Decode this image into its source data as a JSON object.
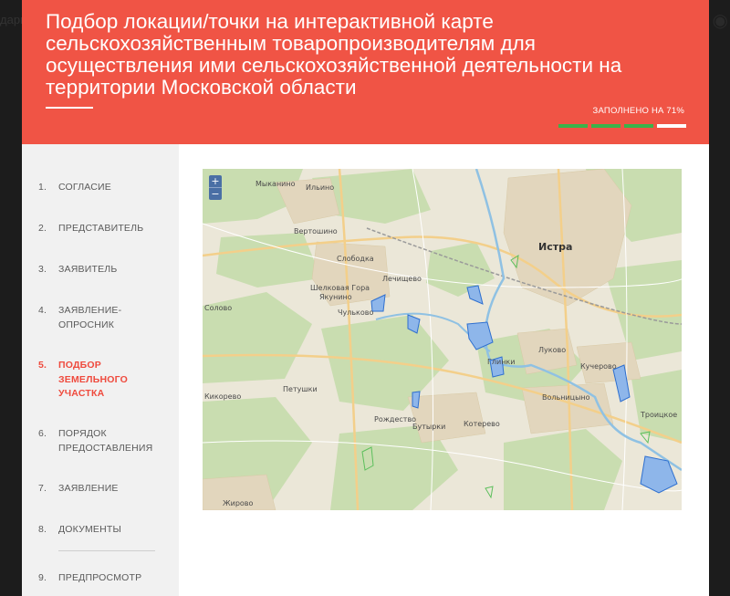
{
  "backdrop": {
    "left_text": "дарг",
    "right_icon": "eye-icon"
  },
  "header": {
    "title": "Подбор локации/точки на интерактивной карте сельскохозяйственным товаропроизводителям для осуществления ими сельскохозяйственной деятельности на территории Московской области",
    "progress_label": "ЗАПОЛНЕНО НА 71%",
    "progress_fraction": 0.75,
    "progress_done_color": "#3bb34a",
    "accent_color": "#f05445"
  },
  "steps": [
    {
      "num": "1.",
      "label": "СОГЛАСИЕ"
    },
    {
      "num": "2.",
      "label": "ПРЕДСТАВИТЕЛЬ"
    },
    {
      "num": "3.",
      "label": "ЗАЯВИТЕЛЬ"
    },
    {
      "num": "4.",
      "label": "ЗАЯВЛЕНИЕ-ОПРОСНИК"
    },
    {
      "num": "5.",
      "label": "ПОДБОР ЗЕМЕЛЬНОГО УЧАСТКА",
      "active": true
    },
    {
      "num": "6.",
      "label": "ПОРЯДОК ПРЕДОСТАВЛЕНИЯ"
    },
    {
      "num": "7.",
      "label": "ЗАЯВЛЕНИЕ"
    },
    {
      "num": "8.",
      "label": "ДОКУМЕНТЫ"
    },
    {
      "num": "9.",
      "label": "ПРЕДПРОСМОТР"
    }
  ],
  "map": {
    "zoom_in": "+",
    "zoom_out": "−",
    "places": {
      "istra": "Истра",
      "mykanino": "Мыканино",
      "ilyino": "Ильино",
      "slobodka": "Слободка",
      "lechishchevo": "Лечищево",
      "shelkovaya_gora": "Шелковая Гора",
      "yakunino": "Якунино",
      "chulkovo": "Чульково",
      "petushki": "Петушки",
      "kikovo": "Кикорево",
      "rozhdestveno": "Рождество",
      "butyrki": "Бутырки",
      "kotelevo": "Котерево",
      "lukovo": "Луково",
      "glinki": "Глинки",
      "kuchkovo": "Кучерово",
      "volodkovo": "Вольницыно",
      "troitskoe": "Троицкое",
      "zhitovo": "Жирово",
      "solovo": "Солово",
      "vertoshino": "Вертошино"
    }
  }
}
